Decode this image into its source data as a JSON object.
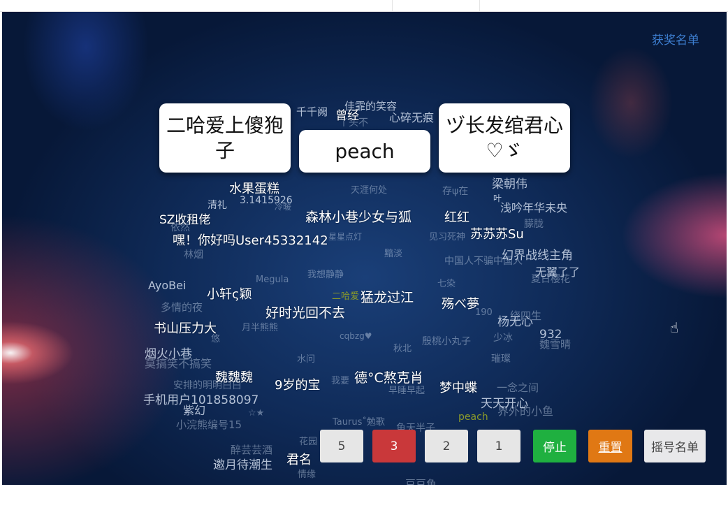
{
  "header": {
    "award_list_label": "获奖名单"
  },
  "winners": [
    "二哈爱上傻狍子",
    "peach",
    "ヅ长发绾君心♡ゞ"
  ],
  "name_cloud": [
    "佳霏的笑容",
    "千千阙",
    "曾经",
    "丫头不",
    "心碎无痕",
    "天涯何处",
    "水果蛋糕",
    "清礼",
    "3.1415926",
    "冷暖",
    "SZ收租佬",
    "依然",
    "森林小巷少女与狐",
    "红红",
    "存ψ在",
    "梁朝伟",
    "叶",
    "浅吟年华未央",
    "朦胧",
    "苏苏苏Su",
    "见习死神",
    "嘿！你好吗User45332142",
    "星星点灯",
    "林烟",
    "黯淡",
    "幻界战线主角",
    "中国人不骗中国人",
    "无翼了了",
    "夏日樱花",
    "我想静静",
    "Megula",
    "七染",
    "AyoBei",
    "小轩ς颖",
    "猛龙过江",
    "二哈爱",
    "殇べ夢",
    "多情的夜",
    "好时光回不去",
    "190",
    "绕四生",
    "杨无心",
    "书山压力大",
    "月半熊熊",
    "悠",
    "cqbzg♥",
    "殷桃小丸子",
    "秋北",
    "少冰",
    "932",
    "魏雪晴",
    "烟火小巷",
    "莫搞笑不搞笑",
    "水问",
    "璀璨",
    "魏魏魏",
    "我要",
    "德°C熬克肖",
    "9岁的宝",
    "安排的明明白白",
    "早睡早起",
    "梦中蝶",
    "一念之间",
    "手机用户101858097",
    "天天开心",
    "界外的小鱼",
    "紫幻",
    "☆★",
    "小浣熊编号15",
    "Taurus˚勉歌",
    "peach",
    "鱼天半子",
    "花园",
    "醉芸芸酒",
    "君名",
    "邀月待潮生",
    "情缘",
    "豆豆鱼"
  ],
  "count_options": [
    "5",
    "3",
    "2",
    "1"
  ],
  "selected_count": "3",
  "buttons": {
    "stop": "停止",
    "reset": "重置",
    "roll_list": "摇号名单"
  },
  "colors": {
    "stop": "#1fb040",
    "reset": "#e07814",
    "selected": "#c9383a",
    "link": "#3d7ed0"
  }
}
